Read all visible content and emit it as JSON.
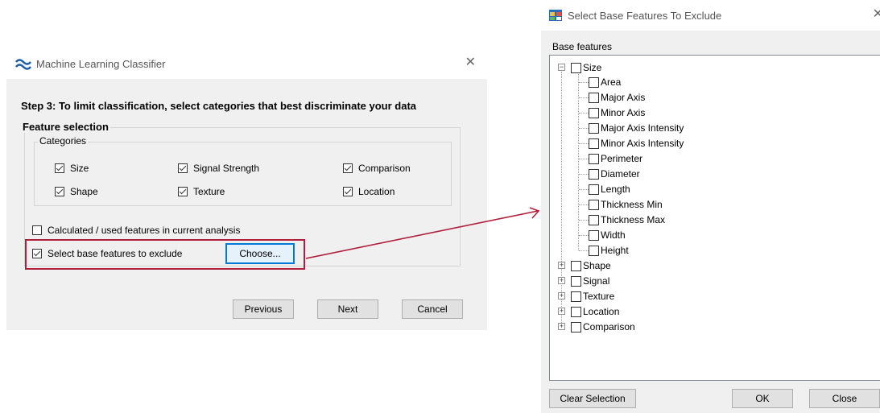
{
  "classifier": {
    "title": "Machine Learning Classifier",
    "step_text": "Step 3: To limit classification, select categories that best discriminate your data",
    "feature_selection_label": "Feature selection",
    "categories_label": "Categories",
    "categories": [
      {
        "label": "Size",
        "checked": true
      },
      {
        "label": "Signal Strength",
        "checked": true
      },
      {
        "label": "Comparison",
        "checked": true
      },
      {
        "label": "Shape",
        "checked": true
      },
      {
        "label": "Texture",
        "checked": true
      },
      {
        "label": "Location",
        "checked": true
      }
    ],
    "calculated_option": {
      "label": "Calculated / used features in current analysis",
      "checked": false
    },
    "exclude_option": {
      "label": "Select base features to exclude",
      "checked": true
    },
    "choose_button": "Choose...",
    "previous_button": "Previous",
    "next_button": "Next",
    "cancel_button": "Cancel"
  },
  "exclude_dialog": {
    "title": "Select Base Features To Exclude",
    "base_features_label": "Base features",
    "tree": {
      "size": {
        "label": "Size",
        "expanded": true,
        "children": [
          "Area",
          "Major Axis",
          "Minor Axis",
          "Major Axis Intensity",
          "Minor Axis Intensity",
          "Perimeter",
          "Diameter",
          "Length",
          "Thickness Min",
          "Thickness Max",
          "Width",
          "Height"
        ]
      },
      "collapsed": [
        "Shape",
        "Signal",
        "Texture",
        "Location",
        "Comparison"
      ]
    },
    "clear_selection_button": "Clear Selection",
    "ok_button": "OK",
    "close_button": "Close"
  },
  "colors": {
    "highlight": "#b01e3c",
    "dialog_bg": "#f0f0f0",
    "accent": "#0078d7"
  }
}
